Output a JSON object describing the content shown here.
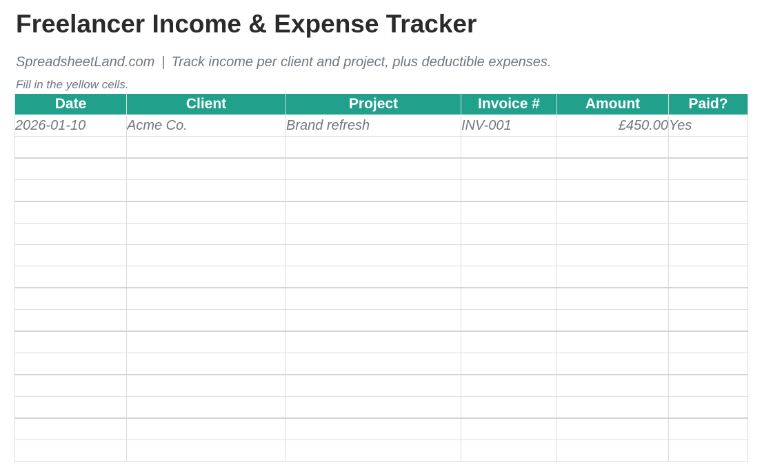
{
  "page": {
    "title": "Freelancer Income & Expense Tracker",
    "subtitle_site": "SpreadsheetLand.com",
    "subtitle_separator": "|",
    "subtitle_text": "Track income per client and project, plus deductible expenses.",
    "note": "Fill in the yellow cells."
  },
  "table": {
    "columns": [
      "Date",
      "Client",
      "Project",
      "Invoice #",
      "Amount",
      "Paid?"
    ],
    "rows": [
      [
        "2026-01-10",
        "Acme Co.",
        "Brand refresh",
        "INV-001",
        "£450.00",
        "Yes"
      ],
      [
        "",
        "",
        "",
        "",
        "",
        ""
      ],
      [
        "",
        "",
        "",
        "",
        "",
        ""
      ],
      [
        "",
        "",
        "",
        "",
        "",
        ""
      ],
      [
        "",
        "",
        "",
        "",
        "",
        ""
      ],
      [
        "",
        "",
        "",
        "",
        "",
        ""
      ],
      [
        "",
        "",
        "",
        "",
        "",
        ""
      ],
      [
        "",
        "",
        "",
        "",
        "",
        ""
      ],
      [
        "",
        "",
        "",
        "",
        "",
        ""
      ],
      [
        "",
        "",
        "",
        "",
        "",
        ""
      ],
      [
        "",
        "",
        "",
        "",
        "",
        ""
      ],
      [
        "",
        "",
        "",
        "",
        "",
        ""
      ],
      [
        "",
        "",
        "",
        "",
        "",
        ""
      ],
      [
        "",
        "",
        "",
        "",
        "",
        ""
      ],
      [
        "",
        "",
        "",
        "",
        "",
        ""
      ],
      [
        "",
        "",
        "",
        "",
        "",
        ""
      ]
    ]
  },
  "colors": {
    "header_bg": "#21a08c",
    "header_text": "#ffffff",
    "grid_line": "#dcdcdc",
    "muted_text": "#707782",
    "title_text": "#2a2a2a"
  }
}
